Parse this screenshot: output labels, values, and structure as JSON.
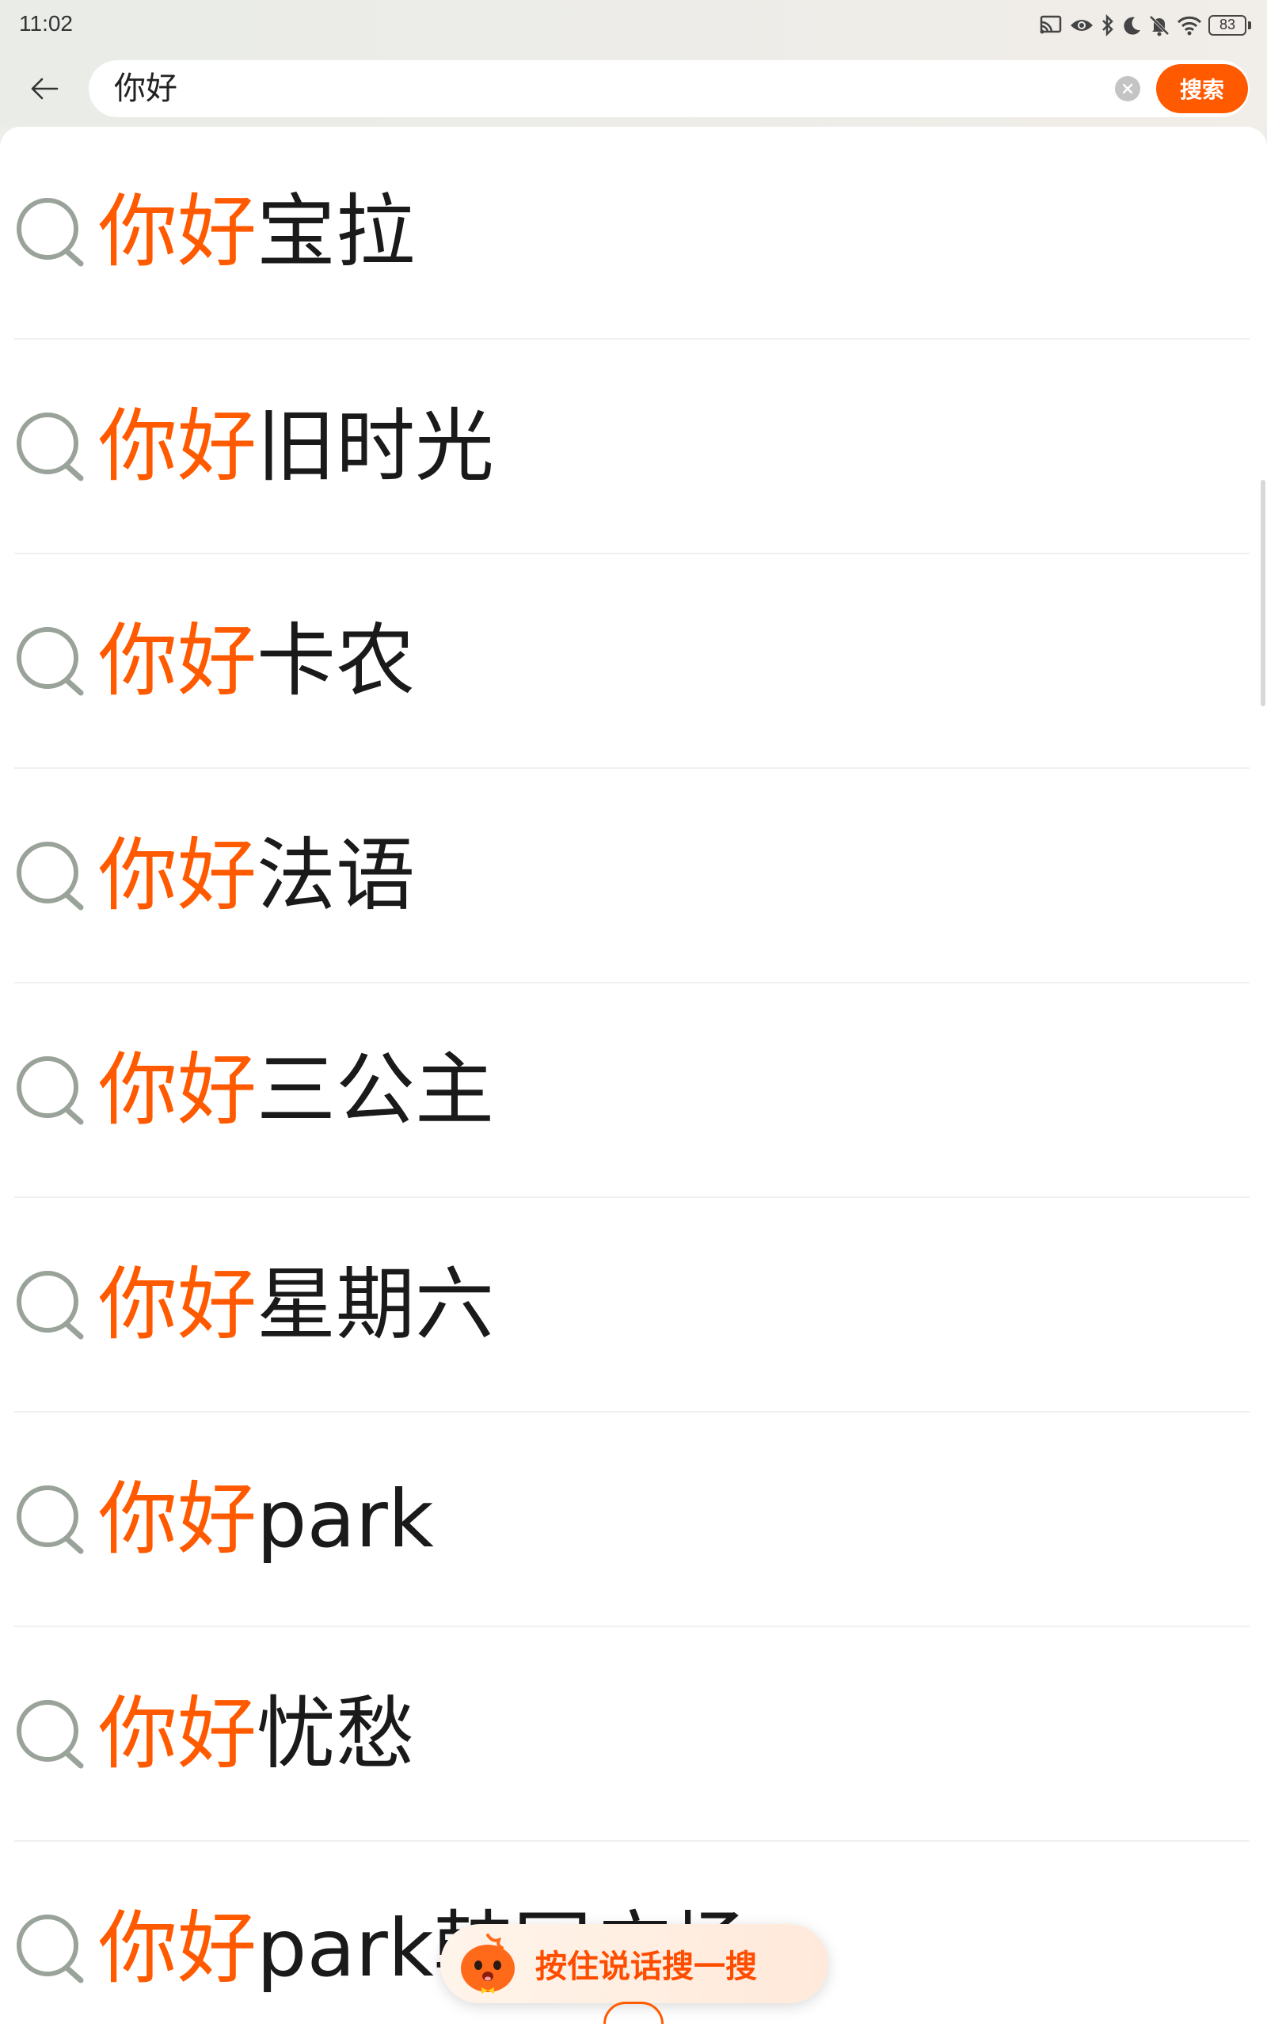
{
  "status_bar": {
    "time": "11:02",
    "battery": "83",
    "icons": [
      "cast-icon",
      "eye-icon",
      "bluetooth-icon",
      "moon-icon",
      "bell-off-icon",
      "wifi-icon",
      "battery-icon"
    ]
  },
  "search": {
    "value": "你好",
    "button_label": "搜索",
    "accent_color": "#ff5a00"
  },
  "suggestions": [
    {
      "highlight": "你好",
      "rest": "宝拉"
    },
    {
      "highlight": "你好",
      "rest": "旧时光"
    },
    {
      "highlight": "你好",
      "rest": "卡农"
    },
    {
      "highlight": "你好",
      "rest": "法语"
    },
    {
      "highlight": "你好",
      "rest": "三公主"
    },
    {
      "highlight": "你好",
      "rest": "星期六"
    },
    {
      "highlight": "你好",
      "rest": "park"
    },
    {
      "highlight": "你好",
      "rest": "忧愁"
    },
    {
      "highlight": "你好",
      "rest": "park韩国广场"
    }
  ],
  "voice_search": {
    "label": "按住说话搜一搜"
  }
}
